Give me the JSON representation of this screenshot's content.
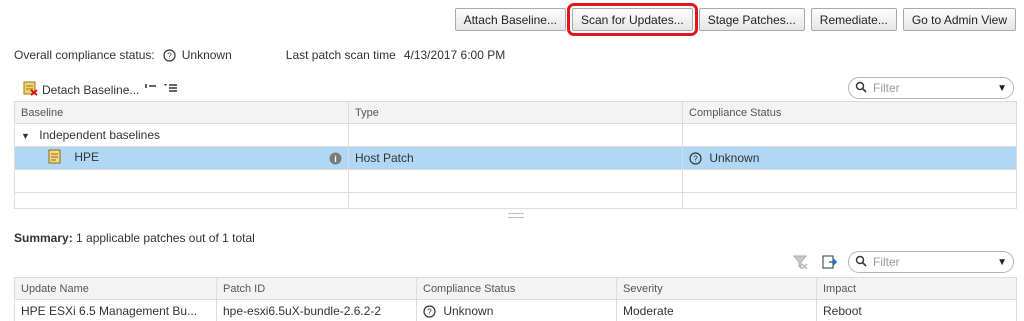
{
  "toolbar": {
    "attach_baseline": "Attach Baseline...",
    "scan_for_updates": "Scan for Updates...",
    "stage_patches": "Stage Patches...",
    "remediate": "Remediate...",
    "go_to_admin_view": "Go to Admin View"
  },
  "status": {
    "overall_label": "Overall compliance status:",
    "overall_value": "Unknown",
    "last_scan_label": "Last patch scan time",
    "last_scan_value": "4/13/2017 6:00 PM"
  },
  "baselines": {
    "detach_label": "Detach Baseline...",
    "filter_placeholder": "Filter",
    "columns": [
      "Baseline",
      "Type",
      "Compliance Status"
    ],
    "group_label": "Independent baselines",
    "rows": [
      {
        "name": "HPE",
        "type": "Host Patch",
        "status": "Unknown"
      }
    ]
  },
  "summary": {
    "label": "Summary:",
    "text": "1 applicable patches out of 1 total"
  },
  "patches": {
    "filter_placeholder": "Filter",
    "columns": [
      "Update Name",
      "Patch ID",
      "Compliance Status",
      "Severity",
      "Impact"
    ],
    "rows": [
      {
        "name": "HPE ESXi 6.5 Management Bu...",
        "patch_id": "hpe-esxi6.5uX-bundle-2.6.2-2",
        "status": "Unknown",
        "severity": "Moderate",
        "impact": "Reboot"
      }
    ]
  },
  "colors": {
    "highlight": "#e0161b",
    "selected_row": "#b0d8f5",
    "info_icon": "#7b7b7b"
  }
}
